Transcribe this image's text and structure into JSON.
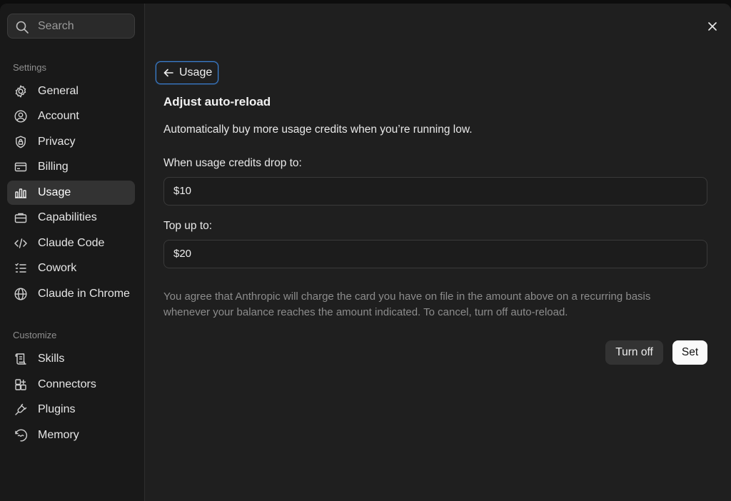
{
  "search": {
    "placeholder": "Search"
  },
  "sidebar": {
    "settings_label": "Settings",
    "customize_label": "Customize",
    "settings_items": [
      {
        "label": "General",
        "icon": "gear-icon"
      },
      {
        "label": "Account",
        "icon": "user-circle-icon"
      },
      {
        "label": "Privacy",
        "icon": "shield-lock-icon"
      },
      {
        "label": "Billing",
        "icon": "credit-card-icon"
      },
      {
        "label": "Usage",
        "icon": "bar-chart-icon",
        "active": true
      },
      {
        "label": "Capabilities",
        "icon": "briefcase-icon"
      },
      {
        "label": "Claude Code",
        "icon": "code-icon"
      },
      {
        "label": "Cowork",
        "icon": "checklist-icon"
      },
      {
        "label": "Claude in Chrome",
        "icon": "globe-icon"
      }
    ],
    "customize_items": [
      {
        "label": "Skills",
        "icon": "scroll-icon"
      },
      {
        "label": "Connectors",
        "icon": "grid-plus-icon"
      },
      {
        "label": "Plugins",
        "icon": "plug-icon"
      },
      {
        "label": "Memory",
        "icon": "memory-icon"
      }
    ]
  },
  "main": {
    "back_label": "Usage",
    "title": "Adjust auto-reload",
    "description": "Automatically buy more usage credits when you’re running low.",
    "threshold_label": "When usage credits drop to:",
    "threshold_value": "$10",
    "topup_label": "Top up to:",
    "topup_value": "$20",
    "note": "You agree that Anthropic will charge the card you have on file in the amount above on a recurring basis whenever your balance reaches the amount indicated. To cancel, turn off auto-reload.",
    "turn_off_label": "Turn off",
    "set_label": "Set"
  },
  "colors": {
    "focus_ring": "#3b82d6",
    "primary_button": "#fafafa",
    "secondary_button": "#333333"
  }
}
